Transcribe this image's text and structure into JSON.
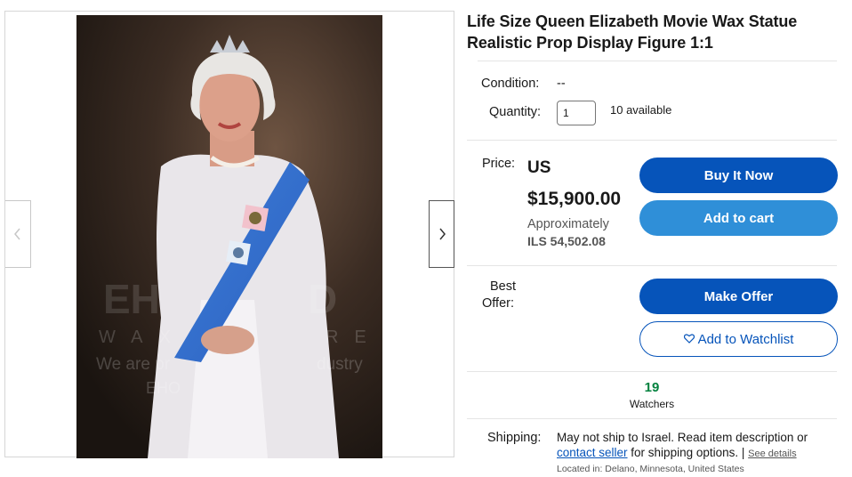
{
  "listing": {
    "title": "Life Size Queen Elizabeth Movie Wax Statue Realistic Prop Display Figure 1:1",
    "condition_label": "Condition:",
    "condition_value": "--",
    "quantity_label": "Quantity:",
    "quantity_value": "1",
    "available": "10 available",
    "price_label": "Price:",
    "price_currency": "US",
    "price_amount": "$15,900.00",
    "approx_label": "Approximately",
    "approx_value": "ILS 54,502.08",
    "best_offer_label_1": "Best",
    "best_offer_label_2": "Offer:",
    "watchers_count": "19",
    "watchers_label": "Watchers",
    "shipping_label": "Shipping:",
    "shipping_text_1": "May not ship to Israel. Read item description or",
    "shipping_link": "contact seller",
    "shipping_text_2": " for shipping options. | ",
    "see_details": "See details",
    "located_in": "Located in: Delano, Minnesota, United States"
  },
  "buttons": {
    "buy_now": "Buy It Now",
    "add_to_cart": "Add to cart",
    "make_offer": "Make Offer",
    "add_to_watchlist": "Add to Watchlist"
  },
  "watermark": {
    "line1": "WAX",
    "line2": "RE",
    "line3": "We are pr",
    "line4": "dustry",
    "line5": "EHO"
  },
  "colors": {
    "primary_blue": "#0654ba",
    "cart_blue": "#2f8fd8",
    "watchers_green": "#05823f"
  },
  "icons": {
    "prev": "chevron-left-icon",
    "next": "chevron-right-icon",
    "heart": "heart-outline-icon"
  }
}
